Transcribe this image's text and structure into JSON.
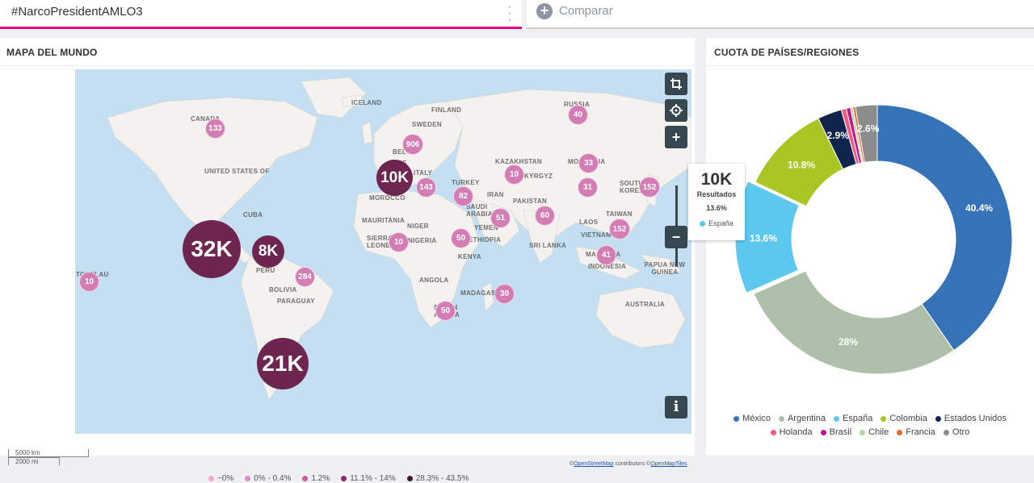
{
  "query": {
    "text": "#NarcoPresidentAMLO3",
    "menu_icon": "more-vertical-icon",
    "accent_color": "#e0087a"
  },
  "compare": {
    "label": "Comparar",
    "icon": "plus-circle-icon"
  },
  "map_panel": {
    "title": "MAPA DEL MUNDO",
    "place_labels": [
      "CANADA",
      "UNITED STATES OF",
      "ICELAND",
      "FINLAND",
      "SWEDEN",
      "RUSSIA",
      "BEL",
      "NCE",
      "ITALY",
      "KAZAKHSTAN",
      "KYRGYZ",
      "MONGOLIA",
      "TURKEY",
      "IRAN",
      "SOUTH KOREA",
      "MOROCCO",
      "SAUDI ARABIA",
      "PAKISTAN",
      "MAURITANIA",
      "NIGER",
      "YEMEN",
      "LAOS",
      "TAIWAN",
      "SIERRA LEONE",
      "NIGERIA",
      "ETHIOPIA",
      "VIETNAM",
      "SRI LANKA",
      "KENYA",
      "MALAYSIA",
      "INDONESIA",
      "PAPUA NEW GUINEA",
      "TOKELAU",
      "PERU",
      "BOLIVIA",
      "PARAGUAY",
      "ANGOLA",
      "MADAGASCAR",
      "SOUTH AFRICA",
      "AUSTRALIA",
      "CUBA"
    ],
    "bubbles": [
      {
        "label": "133",
        "kind": "small"
      },
      {
        "label": "40",
        "kind": "small"
      },
      {
        "label": "906",
        "kind": "small"
      },
      {
        "label": "10K",
        "kind": "mid"
      },
      {
        "label": "143",
        "kind": "small"
      },
      {
        "label": "10",
        "kind": "small"
      },
      {
        "label": "33",
        "kind": "small"
      },
      {
        "label": "82",
        "kind": "small"
      },
      {
        "label": "31",
        "kind": "small"
      },
      {
        "label": "152",
        "kind": "small"
      },
      {
        "label": "32K",
        "kind": "big"
      },
      {
        "label": "51",
        "kind": "small"
      },
      {
        "label": "60",
        "kind": "small"
      },
      {
        "label": "152",
        "kind": "small"
      },
      {
        "label": "10",
        "kind": "small"
      },
      {
        "label": "50",
        "kind": "small"
      },
      {
        "label": "8K",
        "kind": "mid"
      },
      {
        "label": "41",
        "kind": "small"
      },
      {
        "label": "284",
        "kind": "small"
      },
      {
        "label": "10",
        "kind": "small"
      },
      {
        "label": "30",
        "kind": "small"
      },
      {
        "label": "50",
        "kind": "small"
      },
      {
        "label": "21K",
        "kind": "big"
      }
    ],
    "controls": {
      "crop_icon": "crop-icon",
      "locate_icon": "crosshair-icon",
      "zoom_in": "+",
      "zoom_out": "−",
      "info": "i"
    },
    "scale": {
      "km": "5000 km",
      "mi": "2000 mi"
    },
    "attribution": {
      "prefix": "©",
      "osm": "OpenStreetMap",
      "middle": " contributors  ©",
      "tiles": "OpenMapTiles"
    },
    "legend": [
      {
        "label": "~0%",
        "color": "#f0a6d0"
      },
      {
        "label": "0% - 0.4%",
        "color": "#e08ac2"
      },
      {
        "label": "1.2%",
        "color": "#c95ca2"
      },
      {
        "label": "11.1% - 14%",
        "color": "#8a2d67"
      },
      {
        "label": "28.3% - 43.5%",
        "color": "#4a1236"
      }
    ]
  },
  "pie_panel": {
    "title": "CUOTA DE PAÍSES/REGIONES",
    "tooltip": {
      "value": "10K",
      "label": "Resultados",
      "percent": "13.6%",
      "series": "España"
    }
  },
  "chart_data": {
    "type": "pie",
    "title": "CUOTA DE PAÍSES/REGIONES",
    "donut": true,
    "slices": [
      {
        "name": "México",
        "value": 40.4,
        "color": "#3572b8",
        "label": "40.4%"
      },
      {
        "name": "Argentina",
        "value": 28.0,
        "color": "#aebfaa",
        "label": "28%"
      },
      {
        "name": "España",
        "value": 13.6,
        "color": "#5cc8f0",
        "label": "13.6%"
      },
      {
        "name": "Colombia",
        "value": 10.8,
        "color": "#a8c624",
        "label": "10.8%"
      },
      {
        "name": "Estados Unidos",
        "value": 2.9,
        "color": "#10254d",
        "label": "2.9%"
      },
      {
        "name": "Holanda",
        "value": 0.6,
        "color": "#ef5c80",
        "label": ""
      },
      {
        "name": "Brasil",
        "value": 0.5,
        "color": "#c0148a",
        "label": ""
      },
      {
        "name": "Chile",
        "value": 0.3,
        "color": "#b5d99c",
        "label": ""
      },
      {
        "name": "Francia",
        "value": 0.3,
        "color": "#e8682c",
        "label": ""
      },
      {
        "name": "Otro",
        "value": 2.6,
        "color": "#8c8c8c",
        "label": "2.6%"
      }
    ],
    "legend_rows": [
      [
        "México",
        "Argentina",
        "España",
        "Colombia",
        "Estados Unidos"
      ],
      [
        "Holanda",
        "Brasil",
        "Chile",
        "Francia",
        "Otro"
      ]
    ],
    "legend_position": "bottom"
  }
}
